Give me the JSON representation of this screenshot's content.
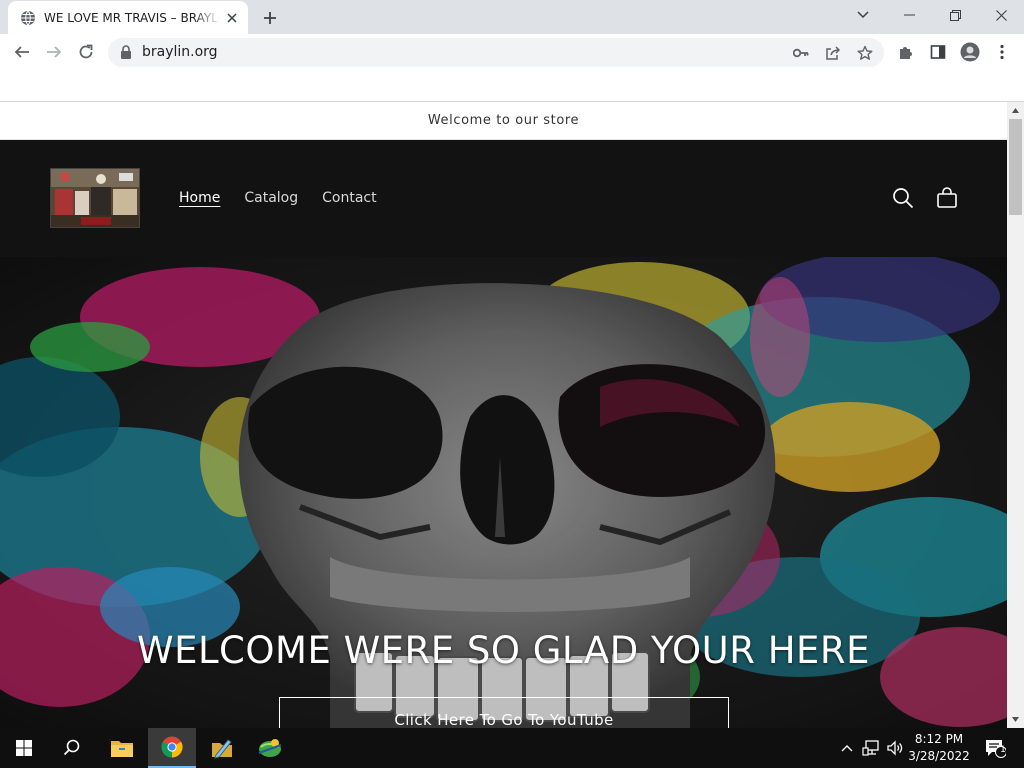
{
  "browser": {
    "tab_title": "WE LOVE MR TRAVIS – BRAYLIN.ORG",
    "url": "braylin.org"
  },
  "store": {
    "announcement": "Welcome to our store",
    "nav": {
      "home": "Home",
      "catalog": "Catalog",
      "contact": "Contact"
    },
    "hero": {
      "title": "WELCOME WERE SO GLAD YOUR HERE",
      "button": "Click Here To Go To YouTube"
    }
  },
  "taskbar": {
    "time": "8:12 PM",
    "date": "3/28/2022",
    "notification_count": "1"
  },
  "colors": {
    "header_bg": "#121212",
    "chrome_tabstrip": "#dee1e6",
    "accent": "#76b9ed"
  }
}
